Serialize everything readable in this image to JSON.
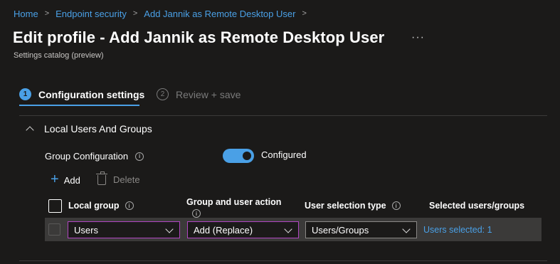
{
  "breadcrumb": {
    "items": [
      "Home",
      "Endpoint security",
      "Add Jannik as Remote Desktop User"
    ],
    "separator": ">"
  },
  "header": {
    "title": "Edit profile - Add Jannik as Remote Desktop User",
    "more_label": "···",
    "subtitle": "Settings catalog (preview)"
  },
  "wizard": {
    "steps": [
      {
        "number": "1",
        "label": "Configuration settings",
        "active": true
      },
      {
        "number": "2",
        "label": "Review + save",
        "active": false
      }
    ]
  },
  "section": {
    "title": "Local Users And Groups",
    "group_configuration": {
      "label": "Group Configuration",
      "info": "i",
      "toggle_state": "on",
      "toggle_label": "Configured"
    },
    "commands": {
      "add_label": "Add",
      "add_icon": "+",
      "delete_label": "Delete"
    },
    "table": {
      "columns": {
        "local_group": "Local group",
        "action": "Group and user action",
        "selection_type": "User selection type",
        "selected": "Selected users/groups"
      },
      "rows": [
        {
          "local_group": "Users",
          "action": "Add (Replace)",
          "selection_type": "Users/Groups",
          "selected": "Users selected: 1"
        }
      ]
    }
  },
  "colors": {
    "background": "#1b1a19",
    "accent": "#4aa0e6",
    "focus_border": "#b146c2",
    "row_background": "#3b3a39"
  }
}
